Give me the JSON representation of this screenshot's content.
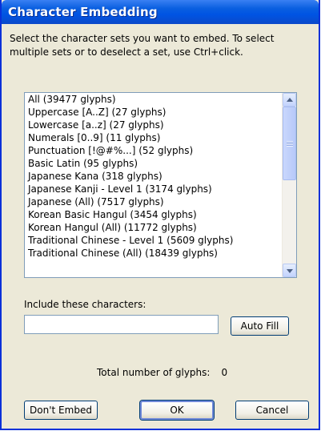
{
  "dialog": {
    "title": "Character Embedding",
    "instructions": "Select the character sets you want to embed. To select multiple sets or to deselect a set, use Ctrl+click."
  },
  "charsets": [
    "All  (39477 glyphs)",
    "Uppercase [A..Z]  (27 glyphs)",
    "Lowercase [a..z]  (27 glyphs)",
    "Numerals [0..9]  (11 glyphs)",
    "Punctuation [!@#%...]  (52 glyphs)",
    "Basic Latin  (95 glyphs)",
    "Japanese Kana  (318 glyphs)",
    "Japanese Kanji - Level 1 (3174 glyphs)",
    "Japanese (All)  (7517 glyphs)",
    "Korean Basic Hangul (3454 glyphs)",
    "Korean Hangul (All) (11772 glyphs)",
    "Traditional Chinese - Level 1 (5609 glyphs)",
    "Traditional Chinese (All)  (18439 glyphs)"
  ],
  "include": {
    "label": "Include these characters:",
    "value": "",
    "auto_fill_label": "Auto Fill"
  },
  "total": {
    "label": "Total number of glyphs:",
    "count": "0"
  },
  "buttons": {
    "dont_embed": "Don't Embed",
    "ok": "OK",
    "cancel": "Cancel"
  }
}
